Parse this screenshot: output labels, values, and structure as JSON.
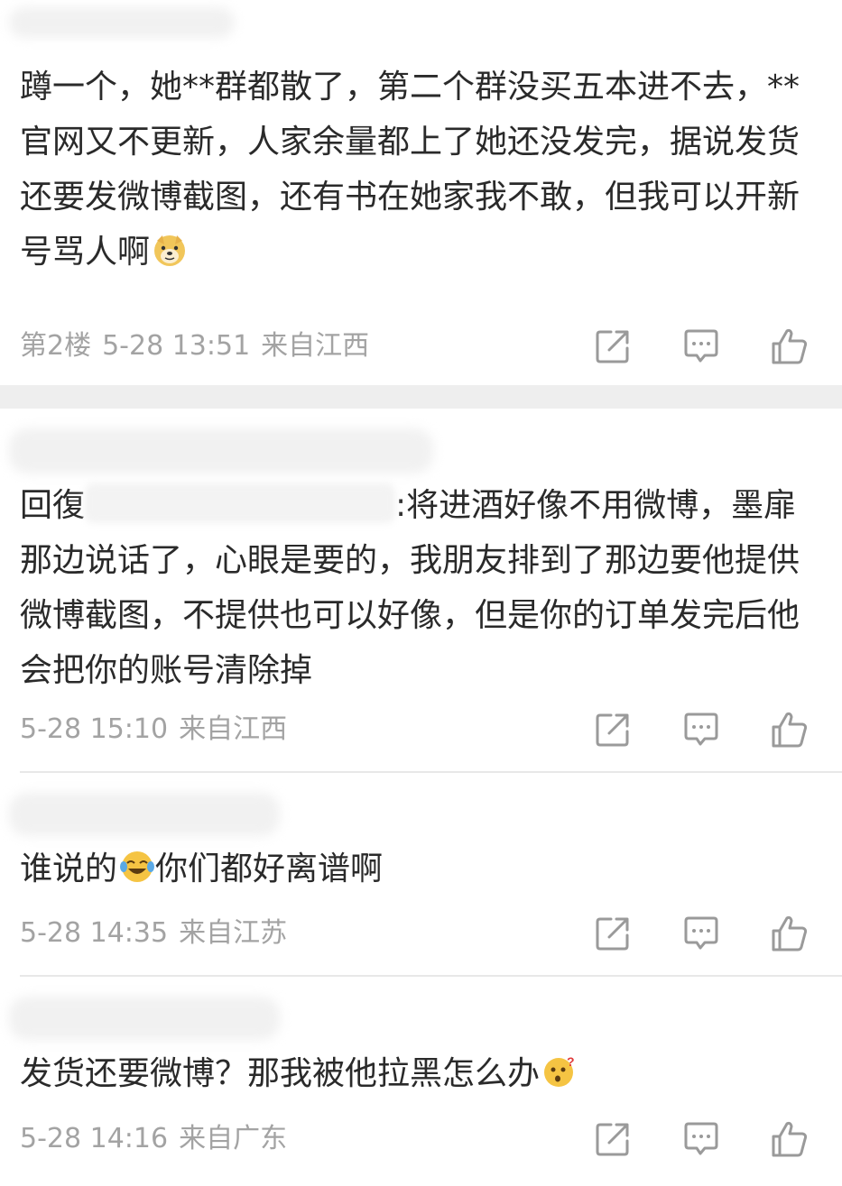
{
  "posts": [
    {
      "text_before": "蹲一个，她**群都散了，第二个群没买五本进不去，**官网又不更新，人家余量都上了她还没发完，据说发货还要发微博截图，还有书在她家我不敢，但我可以开新号骂人啊",
      "emoji": "doge-emoji",
      "floor": "第2楼",
      "time": "5-28 13:51",
      "location": "来自江西"
    },
    {
      "reply_prefix": "回復",
      "text_after": ":将进酒好像不用微博，墨扉那边说话了，心眼是要的，我朋友排到了那边要他提供微博截图，不提供也可以好像，但是你的订单发完后他会把你的账号清除掉",
      "time": "5-28 15:10",
      "location": "来自江西"
    },
    {
      "text_before": "谁说的",
      "emoji": "laugh-cry-emoji",
      "text_after": "你们都好离谱啊",
      "time": "5-28 14:35",
      "location": "来自江苏"
    },
    {
      "text_before": "发货还要微博？那我被他拉黑怎么办",
      "emoji": "confused-emoji",
      "time": "5-28 14:16",
      "location": "来自广东"
    }
  ],
  "actions": {
    "share_icon": "share-icon",
    "comment_icon": "comment-icon",
    "like_icon": "like-icon"
  },
  "colors": {
    "text": "#2a2a2a",
    "meta": "#a3a3a3",
    "divider": "#eeeeee",
    "emoji_yellow": "#f5c443"
  }
}
